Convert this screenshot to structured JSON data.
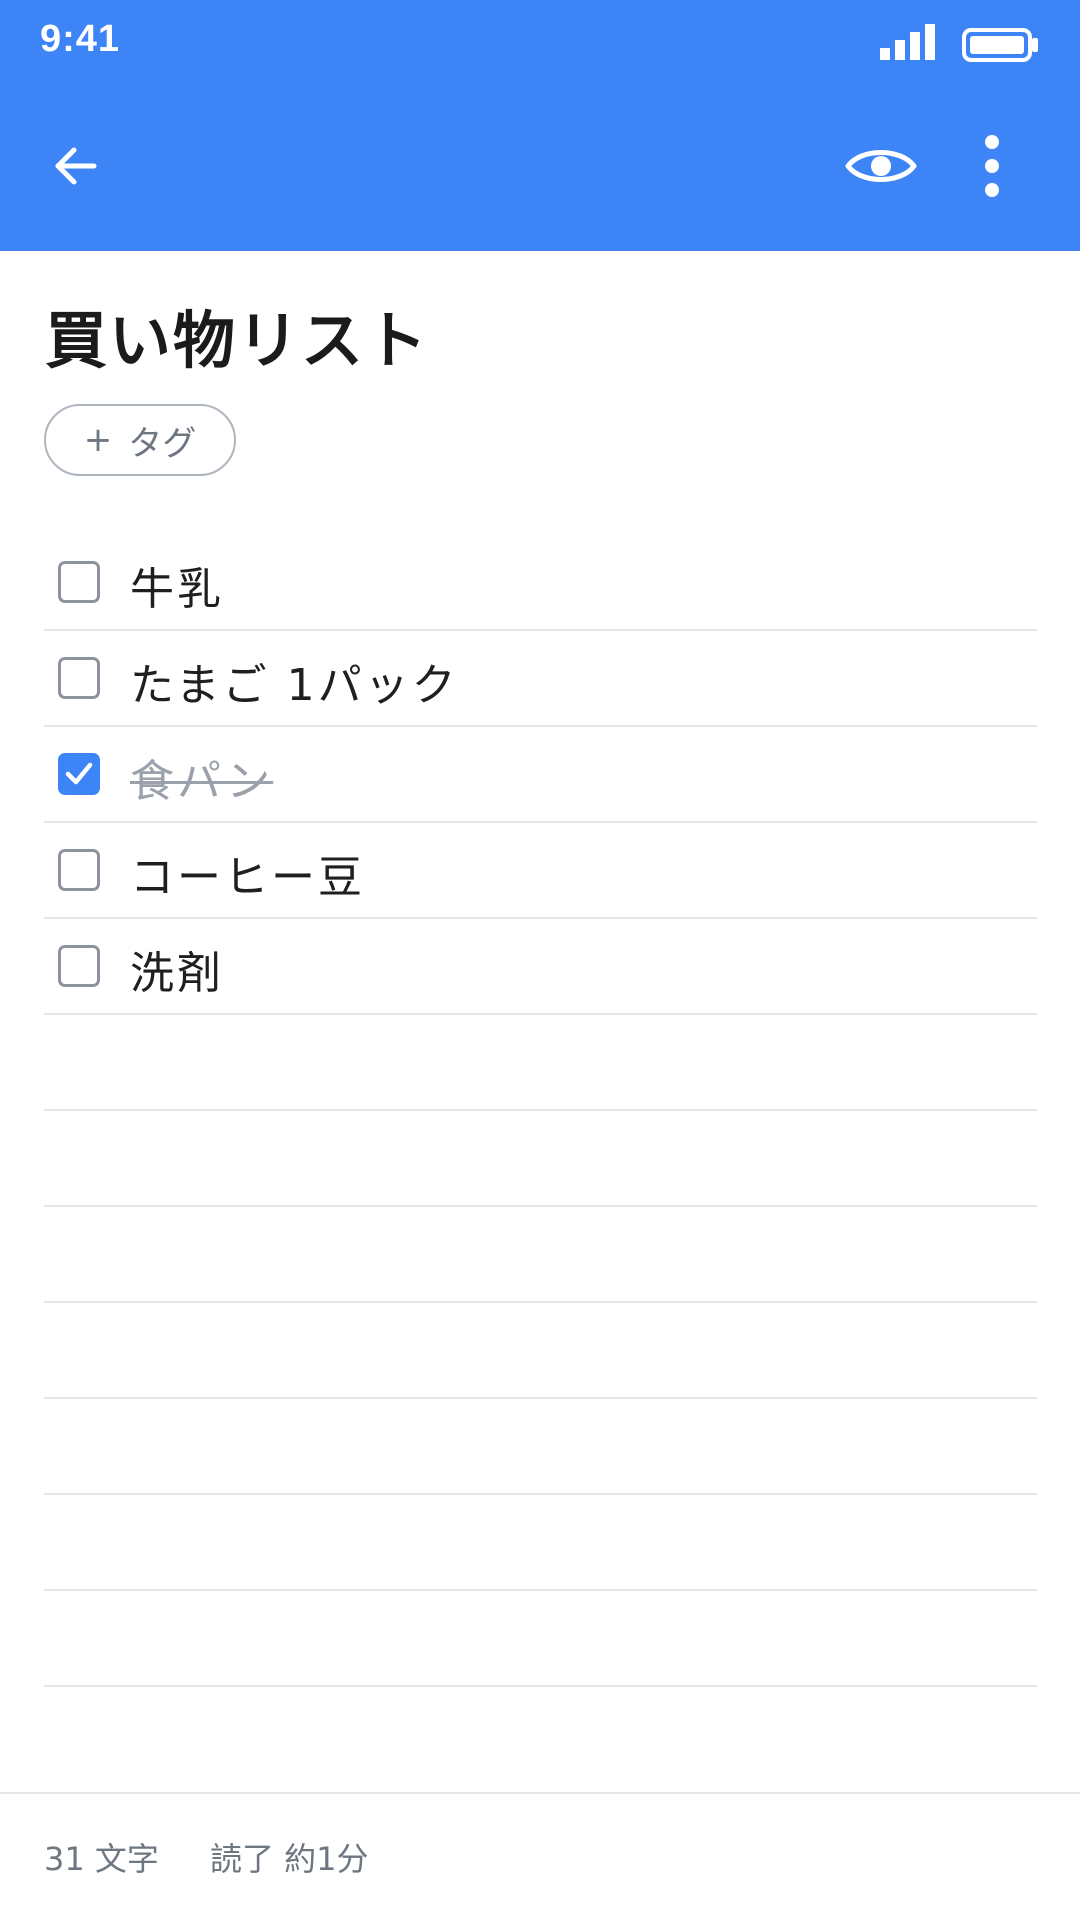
{
  "status_bar": {
    "time": "9:41",
    "icons": [
      "signal-icon",
      "battery-icon"
    ]
  },
  "app_bar": {
    "icons": [
      "back-arrow-icon",
      "eye-icon",
      "more-vertical-icon"
    ],
    "background_color": "#3d84f6"
  },
  "note": {
    "title": "買い物リスト",
    "tag_button": {
      "plus": "+",
      "label": "タグ"
    }
  },
  "checklist": {
    "items": [
      {
        "text": "牛乳",
        "checked": false
      },
      {
        "text": "たまご 1パック",
        "checked": false
      },
      {
        "text": "食パン",
        "checked": true
      },
      {
        "text": "コーヒー豆",
        "checked": false
      },
      {
        "text": "洗剤",
        "checked": false
      }
    ]
  },
  "footer": {
    "char_count": "31 文字",
    "read_time": "読了 約1分"
  }
}
